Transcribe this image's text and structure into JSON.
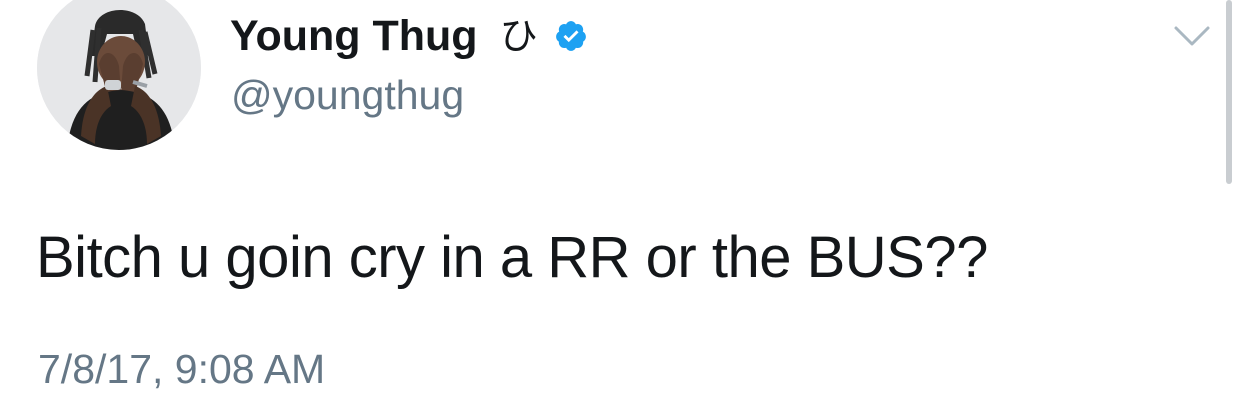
{
  "tweet": {
    "author": {
      "display_name": "Young Thug",
      "name_emoji": "ひ",
      "handle": "@youngthug",
      "verified": true,
      "avatar_icon": "profile-photo"
    },
    "text": "Bitch u goin cry in a RR or the BUS??",
    "timestamp": "7/8/17, 9:08 AM",
    "menu_icon": "chevron-down-icon"
  },
  "colors": {
    "text_primary": "#14171a",
    "text_secondary": "#657786",
    "verified_badge": "#1da1f2",
    "caret": "#aab8c2",
    "background": "#ffffff"
  }
}
